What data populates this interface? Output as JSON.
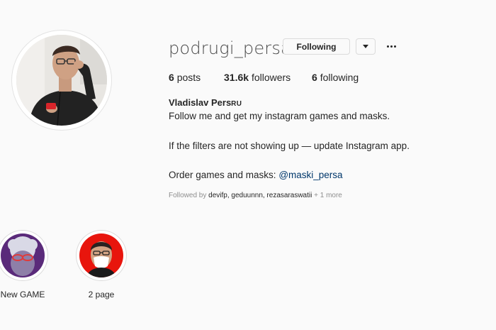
{
  "profile": {
    "username": "podrugi_persa",
    "avatar_icon": "profile-photo"
  },
  "actions": {
    "following_label": "Following",
    "dropdown_icon": "chevron-down-icon",
    "more_icon": "more-options-icon"
  },
  "stats": {
    "posts_count": "6",
    "posts_label": "posts",
    "followers_count": "31.6k",
    "followers_label": "followers",
    "following_count": "6",
    "following_label": "following"
  },
  "bio": {
    "full_name": "Vladislav Pers",
    "full_name_suffix": "RU",
    "line1": "Follow me and get my instagram games and masks.",
    "line2": "If the filters are not showing up — update Instagram app.",
    "line3_prefix": "Order games and masks: ",
    "line3_link": "@maski_persa",
    "followed_by_prefix": "Followed by ",
    "followed_by_names": "devifp, geduunnn, rezasaraswatii",
    "followed_by_more": " + 1 more"
  },
  "highlights": [
    {
      "label": "New GAME",
      "ring_color": "#5a2a7a"
    },
    {
      "label": "2 page",
      "ring_color": "#e8150d"
    }
  ]
}
